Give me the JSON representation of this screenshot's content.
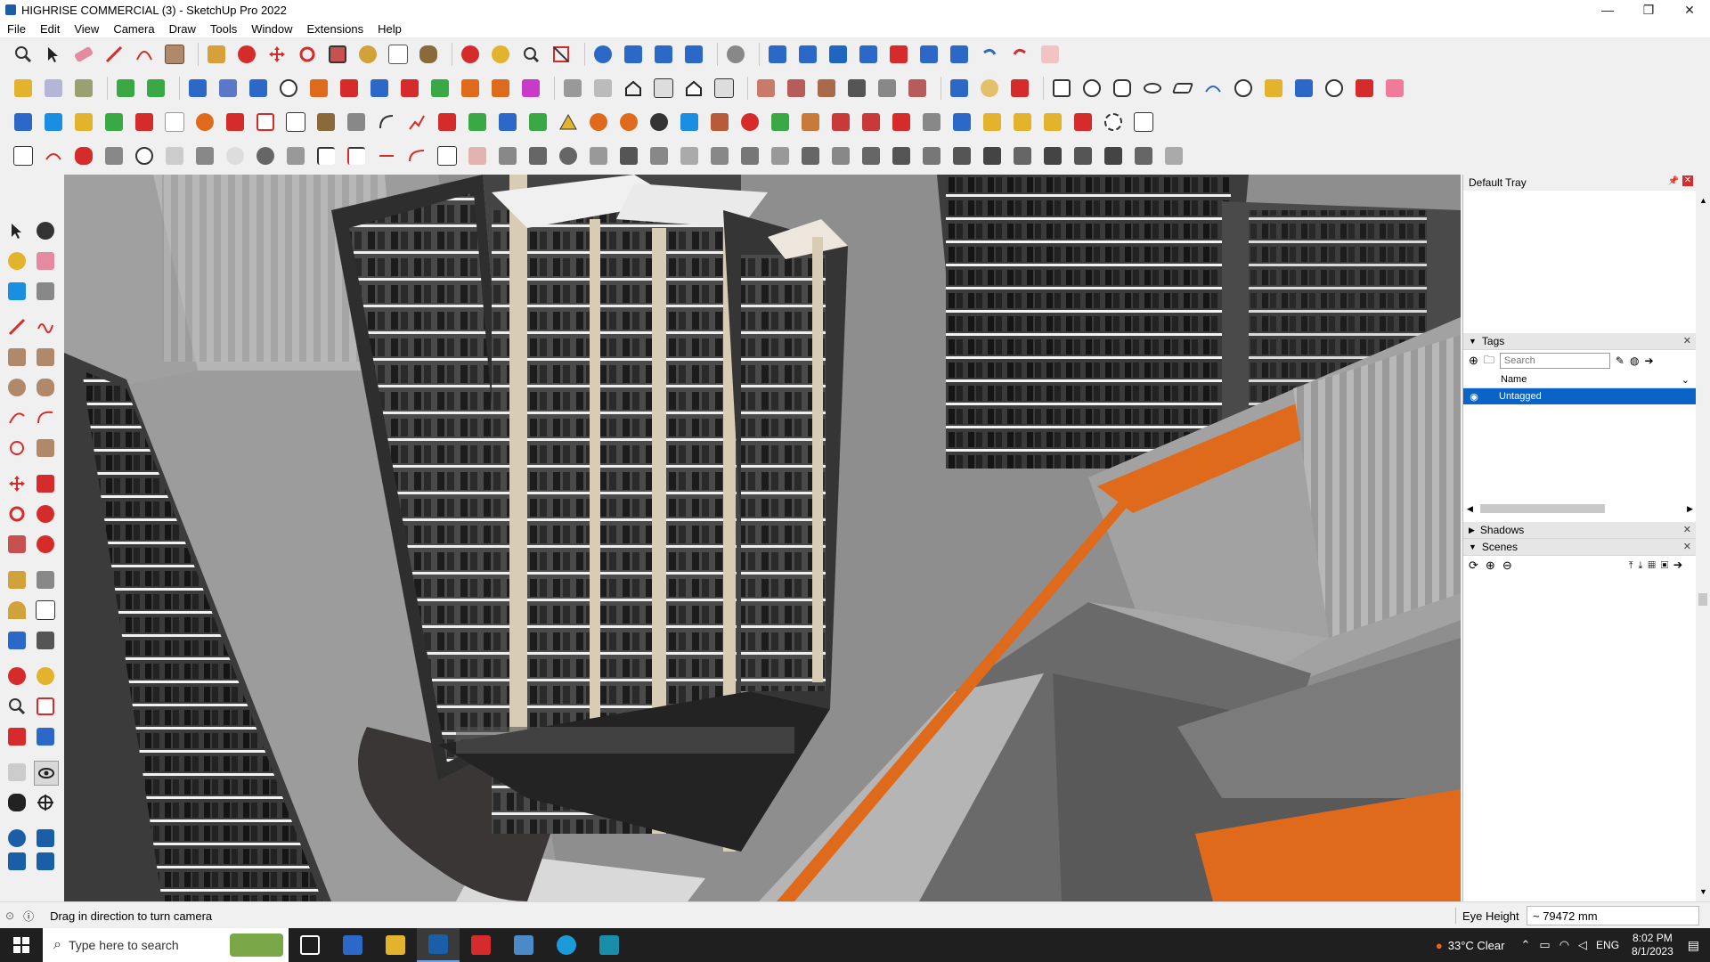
{
  "window": {
    "title": "HIGHRISE COMMERCIAL (3) - SketchUp Pro 2022",
    "minimize": "—",
    "maximize": "❐",
    "close": "✕"
  },
  "menu": [
    "File",
    "Edit",
    "View",
    "Camera",
    "Draw",
    "Tools",
    "Window",
    "Extensions",
    "Help"
  ],
  "tray": {
    "title": "Default Tray",
    "tags": {
      "header": "Tags",
      "search_placeholder": "Search",
      "column_name": "Name",
      "rows": [
        {
          "label": "Untagged",
          "selected": true
        }
      ]
    },
    "shadows": {
      "header": "Shadows"
    },
    "scenes": {
      "header": "Scenes"
    }
  },
  "status": {
    "message": "Drag in direction to turn camera",
    "measure_label": "Eye Height",
    "measure_value": "~ 79472 mm"
  },
  "taskbar": {
    "search_placeholder": "Type here to search",
    "weather": "33°C  Clear",
    "language": "ENG",
    "time": "8:02 PM",
    "date": "8/1/2023"
  },
  "colors": {
    "accent": "#0078d7",
    "selected_row": "#0a64c8",
    "toolbar_orange": "#e06a1b",
    "toolbar_red": "#d62b2b",
    "toolbar_blue": "#2b68c8",
    "toolbar_green": "#3aa845",
    "toolbar_yellow": "#e3b32e"
  },
  "icons": {
    "toolbar_row1": [
      "zoom-icon",
      "select-icon",
      "eraser-icon",
      "pencil-icon",
      "arc-icon",
      "rectangle-icon",
      "push-pull-icon",
      "follow-me-icon",
      "move-icon",
      "rotate-icon",
      "scale-icon",
      "tape-measure-icon",
      "text-icon",
      "paint-bucket-icon",
      "orbit-icon",
      "pan-icon",
      "zoom-window-icon",
      "zoom-extents-icon",
      "warehouse-icon",
      "extension-icon",
      "layout-icon",
      "styles-icon",
      "sandbox-icon",
      "section-icon",
      "solid-tools-icon",
      "undo-icon",
      "redo-icon"
    ],
    "left_tools": [
      "select-icon",
      "orbit-icon",
      "paint-icon",
      "eraser-icon",
      "component-icon",
      "tape-icon",
      "line-icon",
      "freehand-icon",
      "rectangle-icon",
      "rotated-rect-icon",
      "circle-icon",
      "polygon-icon",
      "arc-icon",
      "pie-icon",
      "push-pull-icon",
      "offset-icon",
      "move-icon",
      "follow-me-icon",
      "rotate-icon",
      "scale-icon",
      "tape-measure-icon",
      "text-icon",
      "protractor-icon",
      "axes-icon",
      "pan-icon",
      "orbit-icon",
      "zoom-icon",
      "zoom-window-icon",
      "zoom-extents-icon",
      "walk-icon",
      "look-around-icon",
      "section-icon"
    ]
  }
}
